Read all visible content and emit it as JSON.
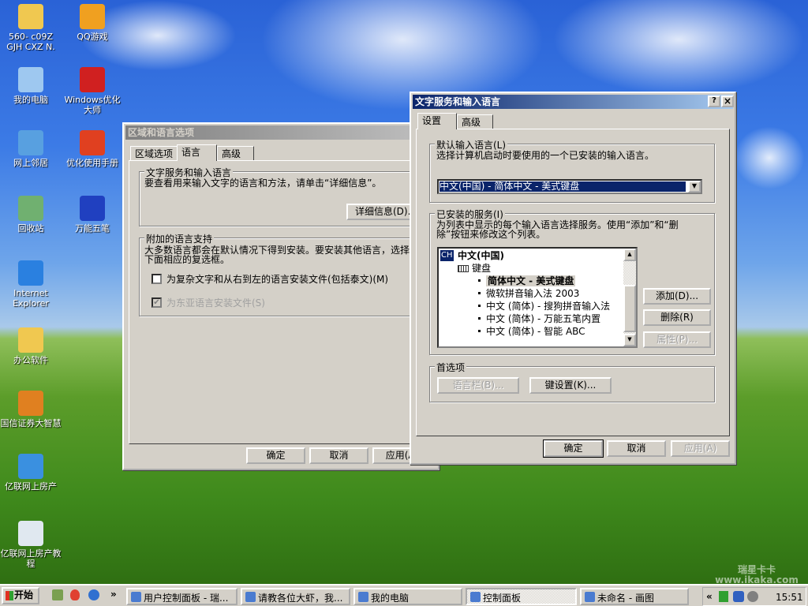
{
  "desktop": {
    "icons": [
      {
        "label": "560- c09Z GJH CXZ N.",
        "icon": "folder-icon",
        "color": "#f0c850"
      },
      {
        "label": "QQ游戏",
        "icon": "qq-game-icon",
        "color": "#f0a020"
      },
      {
        "label": "我的电脑",
        "icon": "my-computer-icon",
        "color": "#9ec8f0"
      },
      {
        "label": "Windows优化大师",
        "icon": "windows-optimizer-icon",
        "color": "#d02020"
      },
      {
        "label": "网上邻居",
        "icon": "network-places-icon",
        "color": "#58a0e0"
      },
      {
        "label": "优化使用手册",
        "icon": "manual-icon",
        "color": "#e04020"
      },
      {
        "label": "回收站",
        "icon": "recycle-bin-icon",
        "color": "#70b070"
      },
      {
        "label": "万能五笔",
        "icon": "wanneng-wubi-icon",
        "color": "#2040c0"
      },
      {
        "label": "Internet Explorer",
        "icon": "internet-explorer-icon",
        "color": "#2a80e0"
      },
      {
        "label": "办公软件",
        "icon": "folder-icon",
        "color": "#f0c850"
      },
      {
        "label": "国信证券大智慧",
        "icon": "stock-app-icon",
        "color": "#e08020"
      },
      {
        "label": "亿联网上房产",
        "icon": "ie-shortcut-icon",
        "color": "#3a90e0"
      },
      {
        "label": "亿联网上房产教程",
        "icon": "window-icon",
        "color": "#e0e8f0"
      }
    ]
  },
  "back_dialog": {
    "title": "区域和语言选项",
    "tabs": [
      "区域选项",
      "语言",
      "高级"
    ],
    "group1": {
      "label": "文字服务和输入语言",
      "text": "要查看用来输入文字的语言和方法，请单击“详细信息”。",
      "details_button": "详细信息(D)..."
    },
    "group2": {
      "label": "附加的语言支持",
      "text1": "大多数语言都会在默认情况下得到安装。要安装其他语言，选择",
      "text2": "下面相应的复选框。",
      "check1": {
        "label": "为复杂文字和从右到左的语言安装文件(包括泰文)(M)",
        "checked": false
      },
      "check2": {
        "label": "为东亚语言安装文件(S)",
        "checked": true,
        "disabled": true
      }
    },
    "ok": "确定",
    "cancel": "取消",
    "apply": "应用(A)"
  },
  "front_dialog": {
    "title": "文字服务和输入语言",
    "help": "?",
    "close": "×",
    "tabs": [
      "设置",
      "高级"
    ],
    "default_group": {
      "label": "默认输入语言(L)",
      "text": "选择计算机启动时要使用的一个已安装的输入语言。",
      "selected": "中文(中国) - 简体中文 - 美式键盘"
    },
    "installed_group": {
      "label": "已安装的服务(I)",
      "text1": "为列表中显示的每个输入语言选择服务。使用“添加”和“删",
      "text2": "除”按钮来修改这个列表。",
      "lang_badge": "CH",
      "language": "中文(中国)",
      "category": "键盘",
      "services": [
        "简体中文 - 美式键盘",
        "微软拼音输入法 2003",
        "中文 (简体) - 搜狗拼音输入法",
        "中文 (简体) - 万能五笔内置",
        "中文 (简体) - 智能 ABC"
      ],
      "add": "添加(D)...",
      "remove": "删除(R)",
      "properties": "属性(P)..."
    },
    "pref_group": {
      "label": "首选项",
      "language_bar": "语言栏(B)...",
      "key_settings": "键设置(K)..."
    },
    "ok": "确定",
    "cancel": "取消",
    "apply": "应用(A)"
  },
  "taskbar": {
    "start": "开始",
    "more": "»",
    "tasks": [
      "用户控制面板 - 瑞...",
      "请教各位大虾，我...",
      "我的电脑",
      "控制面板",
      "未命名 - 画图"
    ],
    "active_task": 3,
    "tray_expand": "«",
    "clock": "15:51"
  },
  "watermark": "瑞星卡卡 www.ikaka.com"
}
